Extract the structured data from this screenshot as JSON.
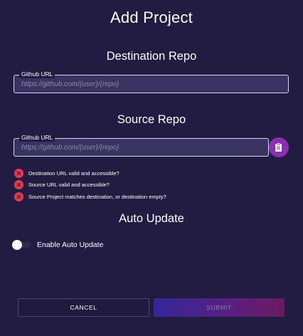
{
  "page": {
    "title": "Add Project"
  },
  "destination": {
    "heading": "Destination Repo",
    "field_label": "Github URL",
    "placeholder": "https://github.com/{user}/{repo}",
    "value": ""
  },
  "source": {
    "heading": "Source Repo",
    "field_label": "Github URL",
    "placeholder": "https://github.com/{user}/{repo}",
    "value": "",
    "paste_icon": "clipboard-paste-icon"
  },
  "validation": {
    "items": [
      {
        "label": "Destination URL valid and accessible?",
        "status": "fail",
        "icon": "error-icon"
      },
      {
        "label": "Source URL valid and accessible?",
        "status": "fail",
        "icon": "error-icon"
      },
      {
        "label": "Source Project matches destination, or destination empty?",
        "status": "fail",
        "icon": "error-icon"
      }
    ]
  },
  "auto_update": {
    "heading": "Auto Update",
    "toggle_label": "Enable Auto Update",
    "enabled": false
  },
  "actions": {
    "cancel_label": "CANCEL",
    "submit_label": "SUBMIT",
    "submit_disabled": true
  },
  "colors": {
    "background": "#221c43",
    "error": "#e53b4d",
    "accent": "#8a2fb0"
  }
}
